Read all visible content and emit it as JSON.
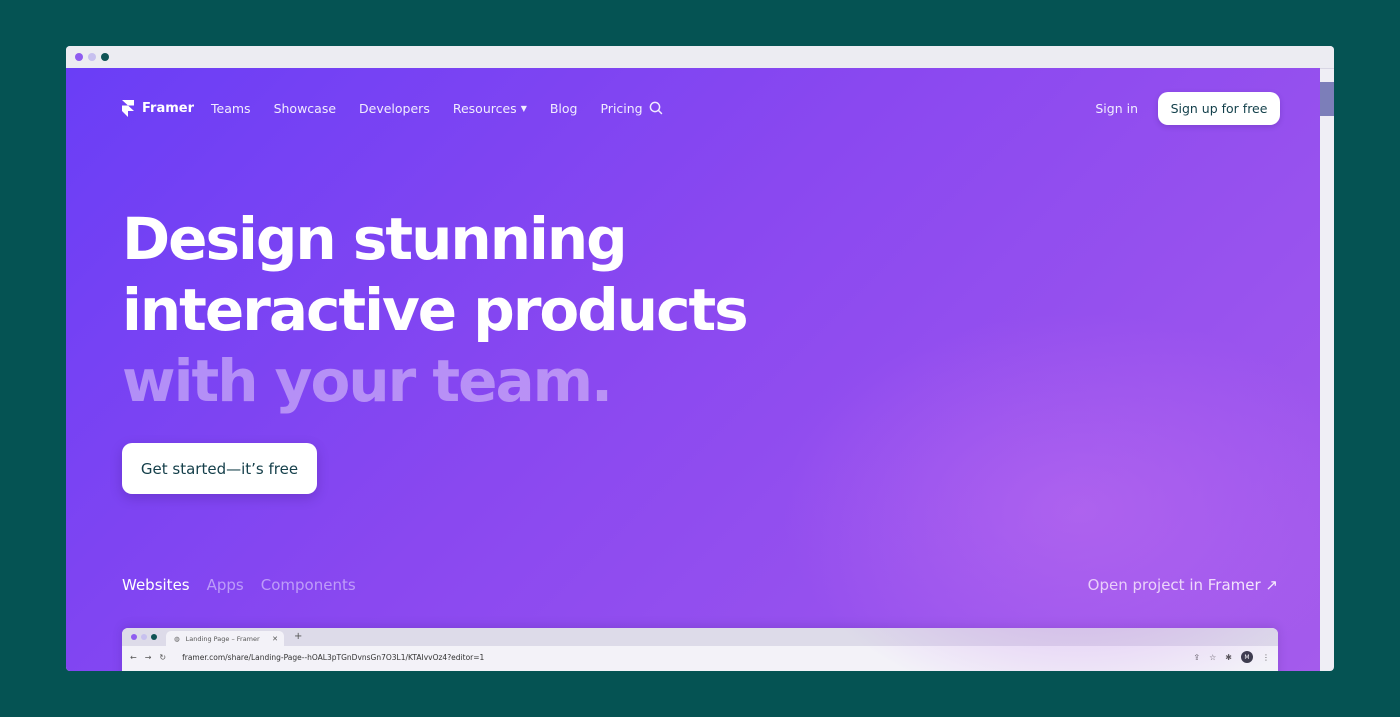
{
  "brand": {
    "name": "Framer"
  },
  "nav": {
    "links": [
      "Teams",
      "Showcase",
      "Developers",
      "Resources",
      "Blog",
      "Pricing"
    ],
    "signin": "Sign in",
    "signup": "Sign up for free"
  },
  "hero": {
    "line1": "Design stunning",
    "line2": "interactive products",
    "line3": "with your team.",
    "cta": "Get started—it’s free"
  },
  "tabs": [
    "Websites",
    "Apps",
    "Components"
  ],
  "open_project": "Open project in Framer ↗",
  "preview": {
    "tab_title": "Landing Page – Framer",
    "url": "framer.com/share/Landing-Page--hOAL3pTGnDvnsGn7O3L1/KTAIvvOz4?editor=1",
    "avatar": "M"
  },
  "colors": {
    "background": "#055353",
    "gradient_start": "#6a3ef6",
    "gradient_end": "#a45bec",
    "button_text": "#16404b"
  }
}
